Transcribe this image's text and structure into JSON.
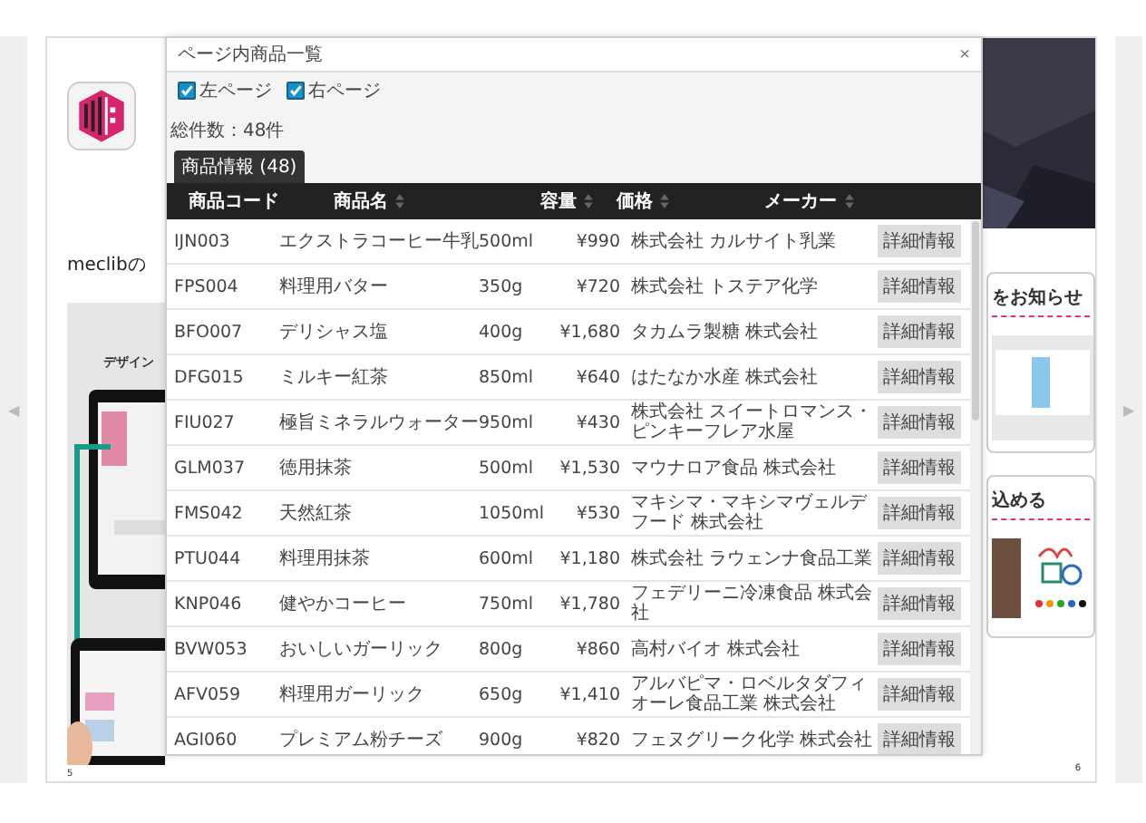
{
  "viewer": {
    "prev_arrow": "◀",
    "next_arrow": "▶"
  },
  "left_page": {
    "heading": "meclibの",
    "caption": "デザイン",
    "page_number": "5"
  },
  "right_page": {
    "cards": [
      {
        "title": "をお知らせ"
      },
      {
        "title": "込める"
      }
    ],
    "page_number": "6"
  },
  "dialog": {
    "title": "ページ内商品一覧",
    "close": "×",
    "filters": [
      {
        "label": "左ページ",
        "checked": true
      },
      {
        "label": "右ページ",
        "checked": true
      }
    ],
    "total": "総件数：48件",
    "tabs": [
      {
        "label": "商品情報 (48)",
        "selected": true
      }
    ],
    "columns": [
      "商品コード",
      "商品名",
      "容量",
      "価格",
      "メーカー"
    ],
    "rows": [
      {
        "code": "IJN003",
        "name": "エクストラコーヒー牛乳",
        "capacity": "500ml",
        "price": "¥990",
        "maker": "株式会社 カルサイト乳業",
        "action": "詳細情報"
      },
      {
        "code": "FPS004",
        "name": "料理用バター",
        "capacity": "350g",
        "price": "¥720",
        "maker": "株式会社 トステア化学",
        "action": "詳細情報"
      },
      {
        "code": "BFO007",
        "name": "デリシャス塩",
        "capacity": "400g",
        "price": "¥1,680",
        "maker": "タカムラ製糖 株式会社",
        "action": "詳細情報"
      },
      {
        "code": "DFG015",
        "name": "ミルキー紅茶",
        "capacity": "850ml",
        "price": "¥640",
        "maker": "はたなか水産 株式会社",
        "action": "詳細情報"
      },
      {
        "code": "FIU027",
        "name": "極旨ミネラルウォーター",
        "capacity": "950ml",
        "price": "¥430",
        "maker": "株式会社 スイートロマンス・ピンキーフレア水屋",
        "action": "詳細情報"
      },
      {
        "code": "GLM037",
        "name": "徳用抹茶",
        "capacity": "500ml",
        "price": "¥1,530",
        "maker": "マウナロア食品 株式会社",
        "action": "詳細情報"
      },
      {
        "code": "FMS042",
        "name": "天然紅茶",
        "capacity": "1050ml",
        "price": "¥530",
        "maker": "マキシマ・マキシマヴェルデフード 株式会社",
        "action": "詳細情報"
      },
      {
        "code": "PTU044",
        "name": "料理用抹茶",
        "capacity": "600ml",
        "price": "¥1,180",
        "maker": "株式会社 ラウェンナ食品工業",
        "action": "詳細情報"
      },
      {
        "code": "KNP046",
        "name": "健やかコーヒー",
        "capacity": "750ml",
        "price": "¥1,780",
        "maker": "フェデリーニ冷凍食品 株式会社",
        "action": "詳細情報"
      },
      {
        "code": "BVW053",
        "name": "おいしいガーリック",
        "capacity": "800g",
        "price": "¥860",
        "maker": "高村バイオ 株式会社",
        "action": "詳細情報"
      },
      {
        "code": "AFV059",
        "name": "料理用ガーリック",
        "capacity": "650g",
        "price": "¥1,410",
        "maker": "アルバピマ・ロベルタダフィオーレ食品工業 株式会社",
        "action": "詳細情報"
      },
      {
        "code": "AGI060",
        "name": "プレミアム粉チーズ",
        "capacity": "900g",
        "price": "¥820",
        "maker": "フェヌグリーク化学 株式会社",
        "action": "詳細情報"
      }
    ]
  }
}
